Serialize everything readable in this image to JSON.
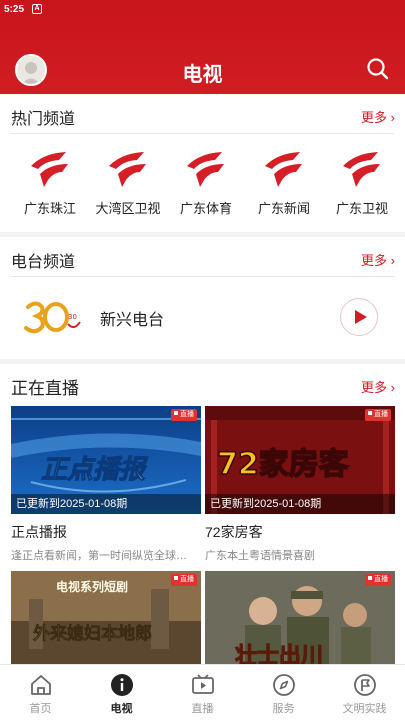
{
  "status_bar": {
    "time": "5:25",
    "notification_glyph": "A"
  },
  "header": {
    "title": "电视",
    "avatar_icon": "user-avatar",
    "search_icon": "search-icon"
  },
  "hot_channels": {
    "title": "热门频道",
    "more": "更多",
    "items": [
      {
        "label": "广东珠江"
      },
      {
        "label": "大湾区卫视"
      },
      {
        "label": "广东体育"
      },
      {
        "label": "广东新闻"
      },
      {
        "label": "广东卫视"
      }
    ],
    "logo_color": "#d51e26"
  },
  "radio": {
    "title": "电台频道",
    "more": "更多",
    "station": {
      "name": "新兴电台",
      "logo_text": "30"
    }
  },
  "live": {
    "title": "正在直播",
    "more": "更多",
    "badge": "直播",
    "items": [
      {
        "title": "正点播报",
        "desc": "逢正点看新闻，第一时间纵览全球…",
        "caption": "已更新到2025-01-08期",
        "art_text": "正点播报"
      },
      {
        "title": "72家房客",
        "desc": "广东本土粤语情景喜剧",
        "caption": "已更新到2025-01-08期",
        "art_text": "72家房客"
      },
      {
        "art_top": "电视系列短剧",
        "art_text": "外来媳妇本地郎"
      },
      {
        "art_text": "壮士出川"
      }
    ]
  },
  "bottom_nav": {
    "items": [
      {
        "label": "首页",
        "icon": "home-icon",
        "active": false
      },
      {
        "label": "电视",
        "icon": "tv-info-icon",
        "active": true
      },
      {
        "label": "直播",
        "icon": "live-video-icon",
        "active": false
      },
      {
        "label": "服务",
        "icon": "compass-icon",
        "active": false
      },
      {
        "label": "文明实践",
        "icon": "flag-icon",
        "active": false
      }
    ]
  },
  "colors": {
    "primary": "#d01d22",
    "text": "#222222",
    "muted": "#888888"
  }
}
